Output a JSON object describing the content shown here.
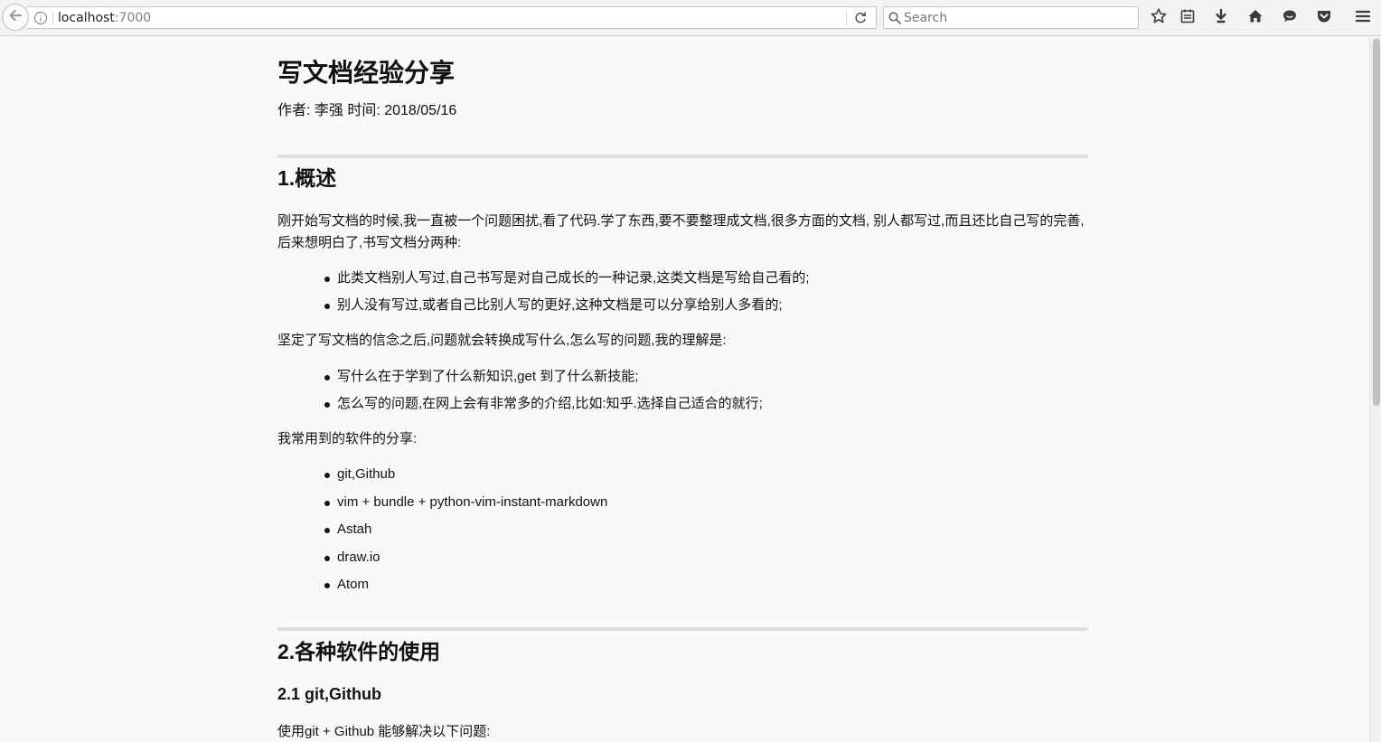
{
  "browser": {
    "url_host": "localhost",
    "url_port": ":7000",
    "search_placeholder": "Search"
  },
  "article": {
    "title": "写文档经验分享",
    "meta": "作者: 李强 时间: 2018/05/16",
    "section1": {
      "heading": "1.概述",
      "intro": "刚开始写文档的时候,我一直被一个问题困扰,看了代码.学了东西,要不要整理成文档,很多方面的文档, 别人都写过,而且还比自己写的完善,后来想明白了,书写文档分两种:",
      "types": [
        "此类文档别人写过,自己书写是对自己成长的一种记录,这类文档是写给自己看的;",
        "别人没有写过,或者自己比别人写的更好,这种文档是可以分享给别人多看的;"
      ],
      "transition": "坚定了写文档的信念之后,问题就会转换成写什么,怎么写的问题,我的理解是:",
      "answers": [
        "写什么在于学到了什么新知识,get 到了什么新技能;",
        "怎么写的问题,在网上会有非常多的介绍,比如:知乎.选择自己适合的就行;"
      ],
      "tools_intro": "我常用到的软件的分享:",
      "tools": [
        "git,Github",
        "vim + bundle + python-vim-instant-markdown",
        "Astah",
        "draw.io",
        "Atom"
      ]
    },
    "section2": {
      "heading": "2.各种软件的使用",
      "sub_heading": "2.1 git,Github",
      "sub_intro": "使用git + Github 能够解决以下问题:"
    }
  },
  "icons": {
    "back": "back-arrow-icon",
    "info": "info-icon",
    "reload": "reload-icon",
    "search": "search-icon",
    "bookmark": "star-icon",
    "library": "reading-list-icon",
    "downloads": "download-icon",
    "home": "home-icon",
    "chat": "chat-icon",
    "pocket": "pocket-icon",
    "menu": "hamburger-menu-icon"
  }
}
